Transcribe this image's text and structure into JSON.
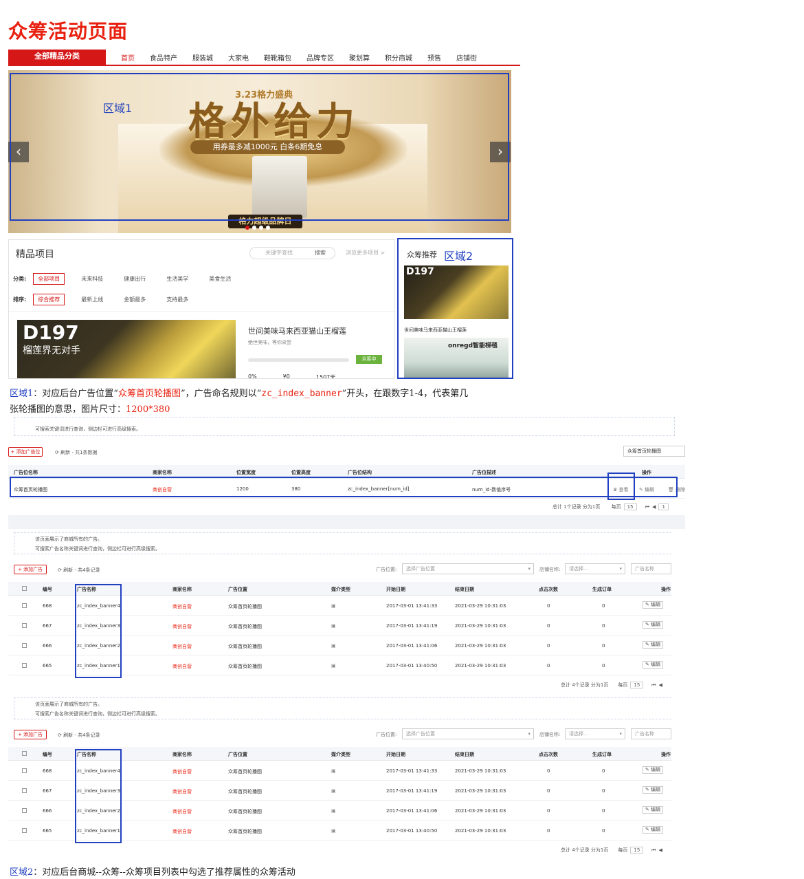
{
  "title": "众筹活动页面",
  "nav": {
    "category_label": "全部精品分类",
    "items": [
      "首页",
      "食品特产",
      "服装城",
      "大家电",
      "鞋靴箱包",
      "品牌专区",
      "聚划算",
      "积分商城",
      "预售",
      "店铺街"
    ]
  },
  "banner": {
    "subtitle": "3.23格力盛典",
    "headline": "格外给力",
    "promo": "用券最多减1000元 白条6期免息",
    "badge": "格力超级品牌日",
    "prev_icon": "‹",
    "next_icon": "›"
  },
  "region1_label": "区域1",
  "region2_label": "区域2",
  "featured": {
    "heading": "精品项目",
    "search_placeholder": "关键字查找",
    "search_button": "搜索",
    "more": "浏览更多项目 >",
    "category_label": "分类:",
    "categories": [
      "全部项目",
      "未来科技",
      "健康出行",
      "生活美学",
      "美食生活"
    ],
    "sort_label": "排序:",
    "sorts": [
      "综合推荐",
      "最新上线",
      "金额最多",
      "支持最多"
    ],
    "product": {
      "img_title": "D197",
      "img_sub": "榴莲界无对手",
      "name": "世间美味马来西亚猫山王榴莲",
      "desc": "绝世美味，等你来尝",
      "status": "众筹中",
      "stats": [
        "0%",
        "¥0",
        "1507天"
      ]
    }
  },
  "recommend": {
    "heading": "众筹推荐",
    "item1_img_title": "D197",
    "item1_caption": "世间美味马来西亚猫山王榴莲",
    "item2_img_title": "onregd智能梯毯"
  },
  "note1": {
    "prefix": "区域1",
    "text_a": "：对应后台广告位置“",
    "highlight": "众筹首页轮播图",
    "text_b": "”，广告命名规则以“",
    "code": "zc_index_banner",
    "text_c": "”开头，在跟数字1-4，代表第几",
    "line2": "张轮播图的意思，图片尺寸：",
    "size": "1200*380"
  },
  "admin1": {
    "tips": [
      "可搜索关键词进行查询，侧边栏可进行高级搜索。"
    ],
    "add_button": "+ 添加广告位",
    "refresh": "刷新 - 共1条数据",
    "search_value": "众筹首页轮播图",
    "headers": [
      "广告位名称",
      "商家名称",
      "位置宽度",
      "位置高度",
      "广告位结构",
      "广告位描述",
      "操作"
    ],
    "row": [
      "众筹首页轮播图",
      "商创自营",
      "1200",
      "380",
      "zc_index_banner[num_id]",
      "num_id-数值序号"
    ],
    "actions": [
      "查看",
      "编辑",
      "删除"
    ],
    "pager_text": "总计 1个记录 分为1页",
    "per_page_label": "每页",
    "per_page": "15",
    "page": "1"
  },
  "admin2": {
    "tips": [
      "该页面展示了商城所有的广告。",
      "可搜索广告名称关键词进行查询，侧边栏可进行高级搜索。"
    ],
    "add_button": "+ 添加广告",
    "refresh": "刷新 - 共4条记录",
    "pos_label": "广告位置:",
    "pos_placeholder": "选择广告位置",
    "shop_label": "店铺名称:",
    "shop_placeholder": "请选择...",
    "name_placeholder": "广告名称",
    "headers": [
      "编号",
      "广告名称",
      "商家名称",
      "广告位置",
      "媒介类型",
      "开始日期",
      "结束日期",
      "点击次数",
      "生成订单",
      "操作"
    ],
    "rows": [
      [
        "668",
        "zc_index_banner4",
        "商创自营",
        "众筹首页轮播图",
        "2017-03-01 13:41:33",
        "2021-03-29 10:31:03",
        "0",
        "0"
      ],
      [
        "667",
        "zc_index_banner3",
        "商创自营",
        "众筹首页轮播图",
        "2017-03-01 13:41:19",
        "2021-03-29 10:31:03",
        "0",
        "0"
      ],
      [
        "666",
        "zc_index_banner2",
        "商创自营",
        "众筹首页轮播图",
        "2017-03-01 13:41:06",
        "2021-03-29 10:31:03",
        "0",
        "0"
      ],
      [
        "665",
        "zc_index_banner1",
        "商创自营",
        "众筹首页轮播图",
        "2017-03-01 13:40:50",
        "2021-03-29 10:31:03",
        "0",
        "0"
      ]
    ],
    "edit": "编辑",
    "pager_text": "总计 4个记录 分为1页",
    "per_page_label": "每页",
    "per_page": "15"
  },
  "note2": {
    "prefix": "区域2",
    "text": "：对应后台商城--众筹--众筹项目列表中勾选了推荐属性的众筹活动"
  },
  "colors": {
    "brand_red": "#d51717",
    "annotation_blue": "#2040c0"
  }
}
